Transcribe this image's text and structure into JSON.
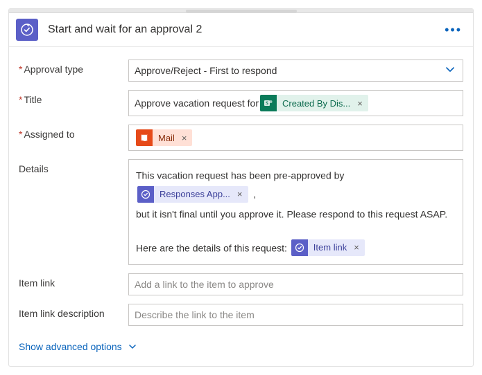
{
  "header": {
    "title": "Start and wait for an approval 2",
    "icon": "approval-check-icon"
  },
  "fields": {
    "approval_type": {
      "label": "Approval type",
      "required": true,
      "value": "Approve/Reject - First to respond"
    },
    "title": {
      "label": "Title",
      "required": true,
      "prefix_text": "Approve vacation request for",
      "token": {
        "kind": "sharepoint",
        "label": "Created By Dis..."
      }
    },
    "assigned_to": {
      "label": "Assigned to",
      "required": true,
      "token": {
        "kind": "office",
        "label": "Mail"
      }
    },
    "details": {
      "label": "Details",
      "required": false,
      "text1": "This vacation request has been pre-approved by",
      "token1": {
        "kind": "approval",
        "label": "Responses App..."
      },
      "text2": "but it isn't final until you approve it. Please respond to this request ASAP.",
      "text3": "Here are the details of this request:",
      "token2": {
        "kind": "approval",
        "label": "Item link"
      }
    },
    "item_link": {
      "label": "Item link",
      "required": false,
      "placeholder": "Add a link to the item to approve",
      "value": ""
    },
    "item_link_desc": {
      "label": "Item link description",
      "required": false,
      "placeholder": "Describe the link to the item",
      "value": ""
    }
  },
  "advanced_toggle": "Show advanced options"
}
